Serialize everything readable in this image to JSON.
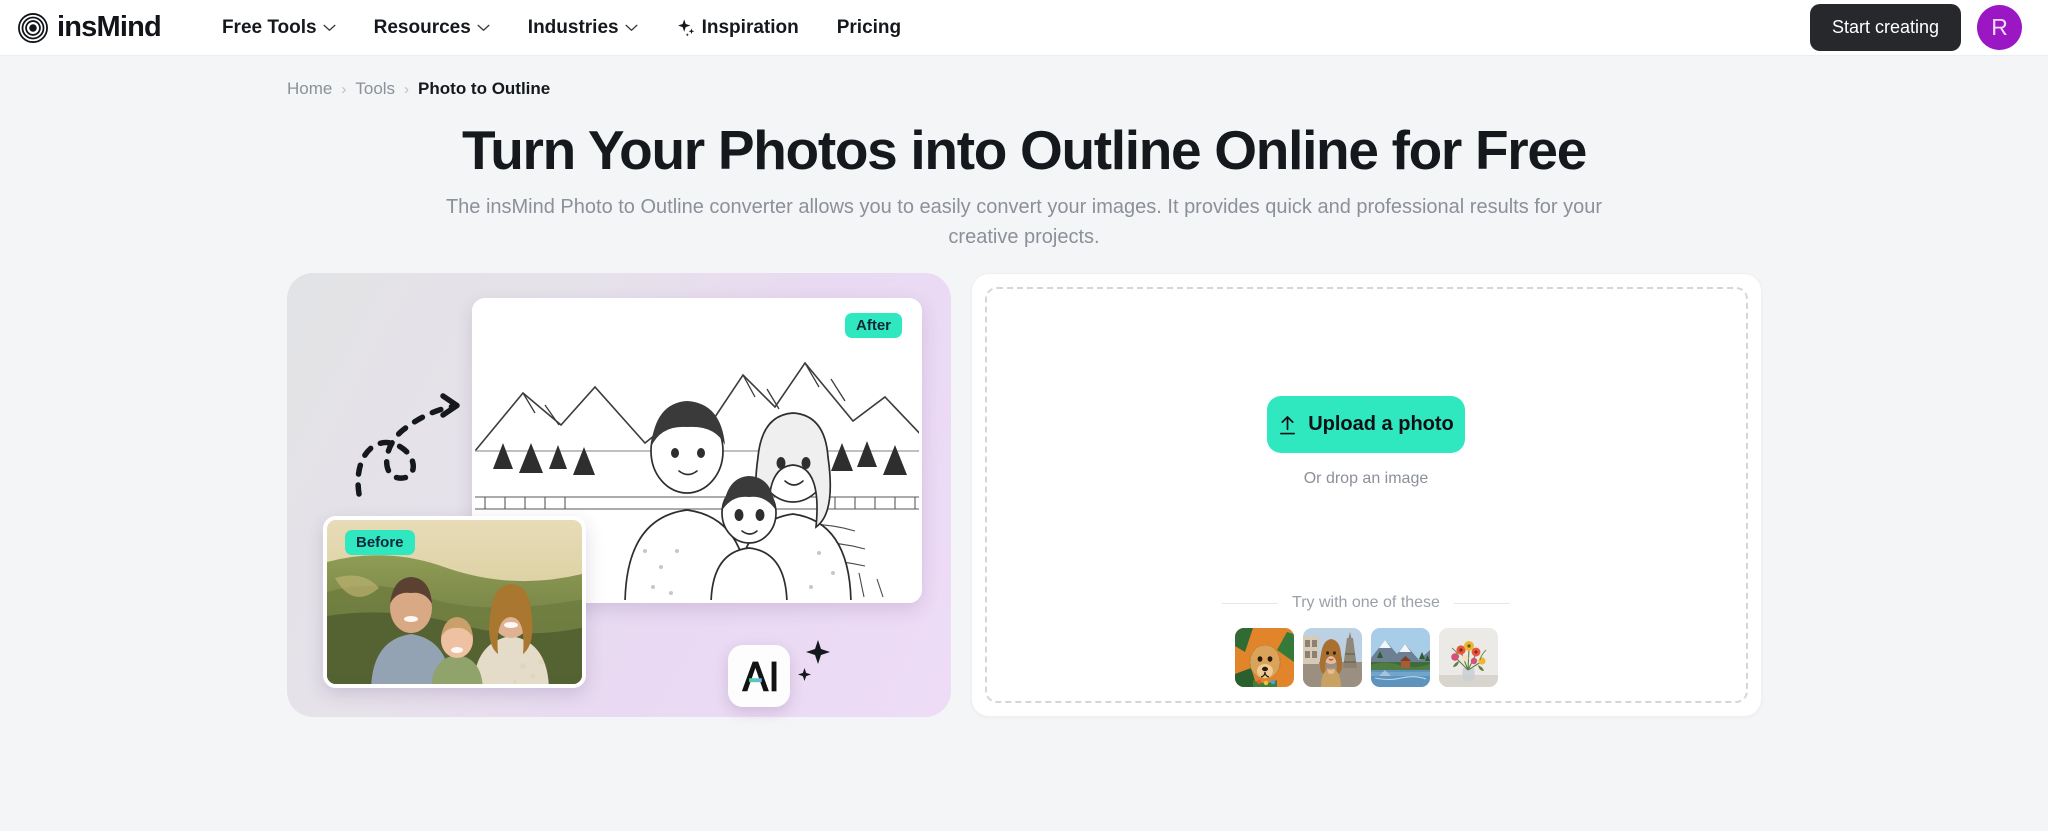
{
  "header": {
    "logo_text": "insMind",
    "logo_icon": "concentric-circles-logo-icon",
    "nav": [
      {
        "label": "Free Tools",
        "has_chevron": true,
        "icon": null
      },
      {
        "label": "Resources",
        "has_chevron": true,
        "icon": null
      },
      {
        "label": "Industries",
        "has_chevron": true,
        "icon": null
      },
      {
        "label": "Inspiration",
        "has_chevron": false,
        "icon": "sparkle-icon"
      },
      {
        "label": "Pricing",
        "has_chevron": false,
        "icon": null
      }
    ],
    "cta_label": "Start creating",
    "avatar_initial": "R",
    "avatar_color": "#9b17c4"
  },
  "breadcrumb": {
    "items": [
      "Home",
      "Tools",
      "Photo to Outline"
    ],
    "separator": "›"
  },
  "hero": {
    "title": "Turn Your Photos into Outline Online for Free",
    "subtitle": "The insMind Photo to Outline converter allows you to easily convert your images. It provides quick and professional results for your creative projects.",
    "badge_after": "After",
    "badge_before": "Before",
    "ai_badge_text": "AI",
    "arrow_icon": "dashed-curved-arrow-icon",
    "sparkle_icon": "sparkle-icon",
    "before_image": "family-portrait-photo-in-meadow",
    "after_image": "family-portrait-line-art-outline-with-mountains"
  },
  "upload": {
    "button_label": "Upload a photo",
    "button_icon": "upload-arrow-icon",
    "button_color": "#2fe8bf",
    "drop_hint": "Or drop an image",
    "try_label": "Try with one of these",
    "samples": [
      {
        "name": "golden-retriever-photo"
      },
      {
        "name": "woman-eiffel-tower-photo"
      },
      {
        "name": "mountain-lake-landscape-photo"
      },
      {
        "name": "flower-bouquet-vase-photo"
      }
    ]
  }
}
